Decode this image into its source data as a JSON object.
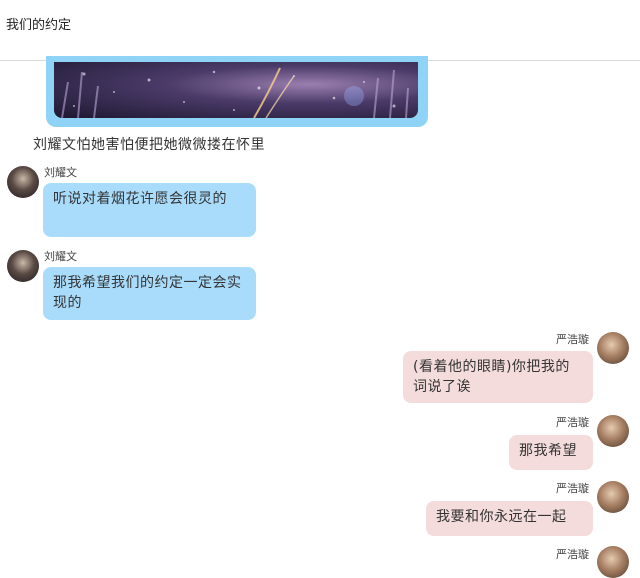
{
  "header": {
    "title": "我们的约定"
  },
  "image_message": {
    "image": "fireworks-photo"
  },
  "narration": "刘耀文怕她害怕便把她微微搂在怀里",
  "messages": [
    {
      "sender": "刘耀文",
      "text": "听说对着烟花许愿会很灵的",
      "side": "left"
    },
    {
      "sender": "刘耀文",
      "text": "那我希望我们的约定一定会实现的",
      "side": "left"
    },
    {
      "sender": "严浩璇",
      "text": "(看着他的眼睛)你把我的词说了诶",
      "side": "right"
    },
    {
      "sender": "严浩璇",
      "text": "那我希望",
      "side": "right"
    },
    {
      "sender": "严浩璇",
      "text": "我要和你永远在一起",
      "side": "right"
    },
    {
      "sender": "严浩璇",
      "text": "",
      "side": "right"
    }
  ],
  "colors": {
    "incoming_bubble": "#a9dcfb",
    "outgoing_bubble": "#f4dcdc",
    "image_border": "#8fd3f7"
  }
}
